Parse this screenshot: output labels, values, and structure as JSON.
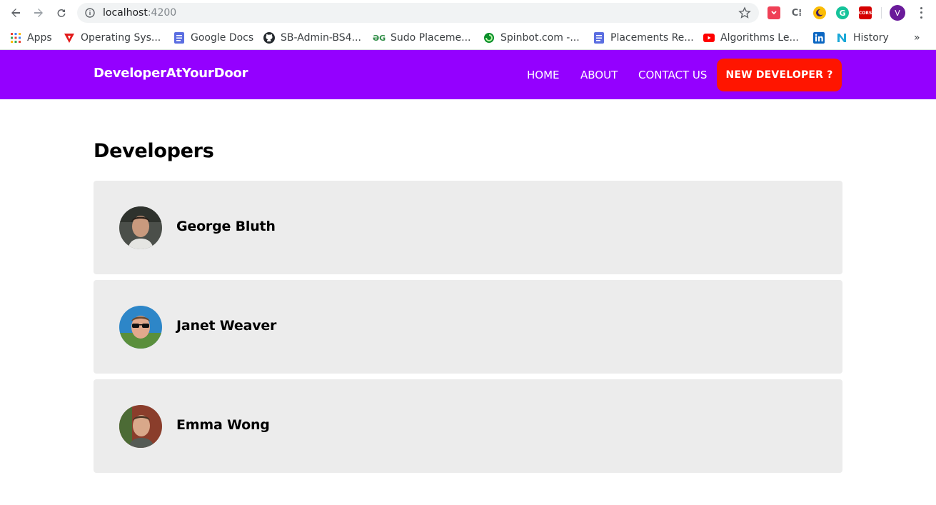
{
  "browser": {
    "url_host": "localhost",
    "url_port": ":4200",
    "profile_initial": "V",
    "more_label": "»",
    "extensions": [
      {
        "name": "pocket-icon",
        "color": "#ef4056",
        "glyph": "◆"
      },
      {
        "name": "chrome-extension-icon",
        "color": "#ffffff",
        "glyph": "C"
      },
      {
        "name": "crescent-extension-icon",
        "color": "#fbbc04",
        "glyph": "◐"
      },
      {
        "name": "grammarly-icon",
        "color": "#15c39a",
        "glyph": "G"
      },
      {
        "name": "cors-extension-icon",
        "color": "#d50000",
        "glyph": "CORS"
      }
    ],
    "bookmarks": [
      {
        "label": "Apps",
        "icon": "apps-grid-icon"
      },
      {
        "label": "Operating Sys...",
        "icon": "red-triangle-icon"
      },
      {
        "label": "Google Docs",
        "icon": "google-docs-icon"
      },
      {
        "label": "SB-Admin-BS4...",
        "icon": "github-icon"
      },
      {
        "label": "Sudo Placeme...",
        "icon": "geeksforgeeks-icon"
      },
      {
        "label": "Spinbot.com -...",
        "icon": "spinbot-icon"
      },
      {
        "label": "Placements Re...",
        "icon": "google-docs-icon"
      },
      {
        "label": "Algorithms Le...",
        "icon": "youtube-icon"
      },
      {
        "label": "",
        "icon": "linkedin-icon"
      },
      {
        "label": "History",
        "icon": "notion-n-icon"
      }
    ]
  },
  "navbar": {
    "brand": "DeveloperAtYourDoor",
    "links": [
      "HOME",
      "ABOUT",
      "CONTACT US"
    ],
    "cta": "NEW DEVELOPER ?",
    "bg_color": "#9400ff",
    "cta_color": "#ff1500"
  },
  "main": {
    "title": "Developers",
    "developers": [
      {
        "name": "George Bluth"
      },
      {
        "name": "Janet Weaver"
      },
      {
        "name": "Emma Wong"
      }
    ]
  }
}
